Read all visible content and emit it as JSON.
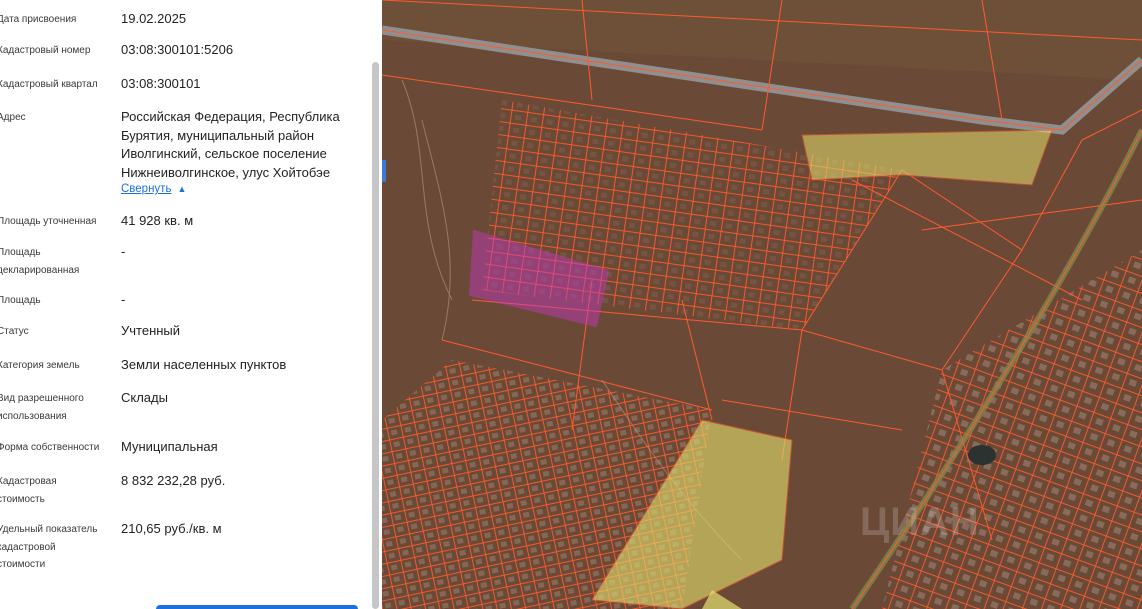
{
  "properties": [
    {
      "label": "Дата присвоения",
      "value": "19.02.2025"
    },
    {
      "label": "Кадастровый номер",
      "value": "03:08:300101:5206"
    },
    {
      "label": "Кадастровый квартал",
      "value": "03:08:300101"
    },
    {
      "label": "Адрес",
      "value": "Российская Федерация, Республика Бурятия, муниципальный район Иволгинский, сельское поселение Нижнеиволгинское, улус Хойтобэе"
    },
    {
      "label": "Площадь уточненная",
      "value": "41 928 кв. м"
    },
    {
      "label": "Площадь декларированная",
      "value": "-"
    },
    {
      "label": "Площадь",
      "value": "-"
    },
    {
      "label": "Статус",
      "value": "Учтенный"
    },
    {
      "label": "Категория земель",
      "value": "Земли населенных пунктов"
    },
    {
      "label": "Вид разрешенного использования",
      "value": "Склады"
    },
    {
      "label": "Форма собственности",
      "value": "Муниципальная"
    },
    {
      "label": "Кадастровая стоимость",
      "value": "8 832 232,28 руб."
    },
    {
      "label": "Удельный показатель кадастровой стоимости",
      "value": "210,65 руб./кв. м"
    }
  ],
  "collapse_link": "Свернуть",
  "map": {
    "watermark": "ЦИАН",
    "colors": {
      "terrain": "#6a4a36",
      "parcel_line": "#ff5a2e",
      "selected_parcel": "#c838c8",
      "yellow_parcel": "#e6e070",
      "road": "#8f8f8f"
    }
  }
}
